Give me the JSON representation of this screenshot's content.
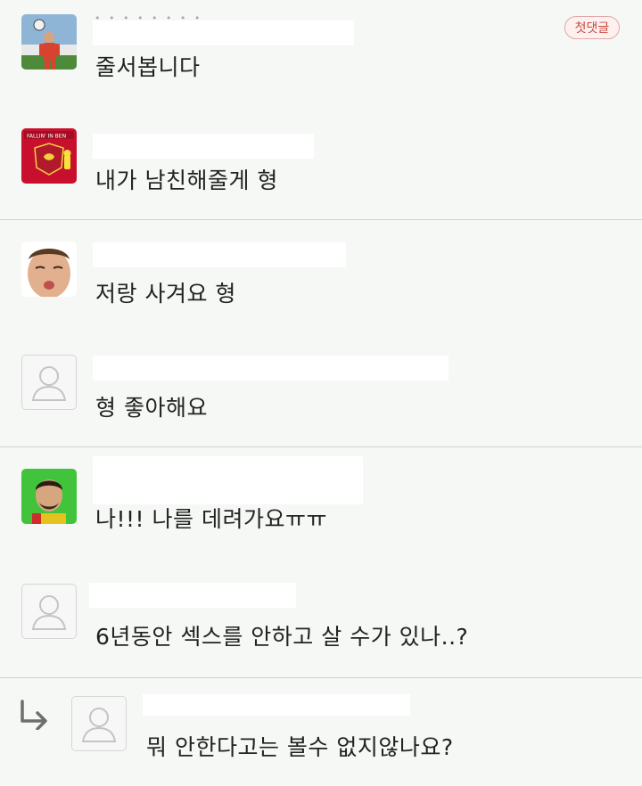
{
  "badge": {
    "first_comment": "첫댓글"
  },
  "comments": [
    {
      "text": "줄서봅니다",
      "avatar": "soccer-player-photo"
    },
    {
      "text": "내가 남친해줄게 형",
      "avatar": "liverpool-crest-image"
    },
    {
      "text": "저랑 사겨요 형",
      "avatar": "kissing-face-photo"
    },
    {
      "text": "형 좋아해요",
      "avatar": "default-user-icon"
    },
    {
      "text": "나!!! 나를 데려가요ㅠㅠ",
      "avatar": "man-on-green-background-photo"
    },
    {
      "text": "6년동안 섹스를 안하고 살 수가 있나..?",
      "avatar": "default-user-icon"
    }
  ],
  "reply": {
    "text": "뭐 안한다고는 볼수 없지않나요?",
    "avatar": "default-user-icon"
  },
  "colors": {
    "background": "#f5f8f5",
    "divider": "#cfd3cf",
    "badge_text": "#c94a40",
    "badge_border": "#e0a8a8"
  }
}
